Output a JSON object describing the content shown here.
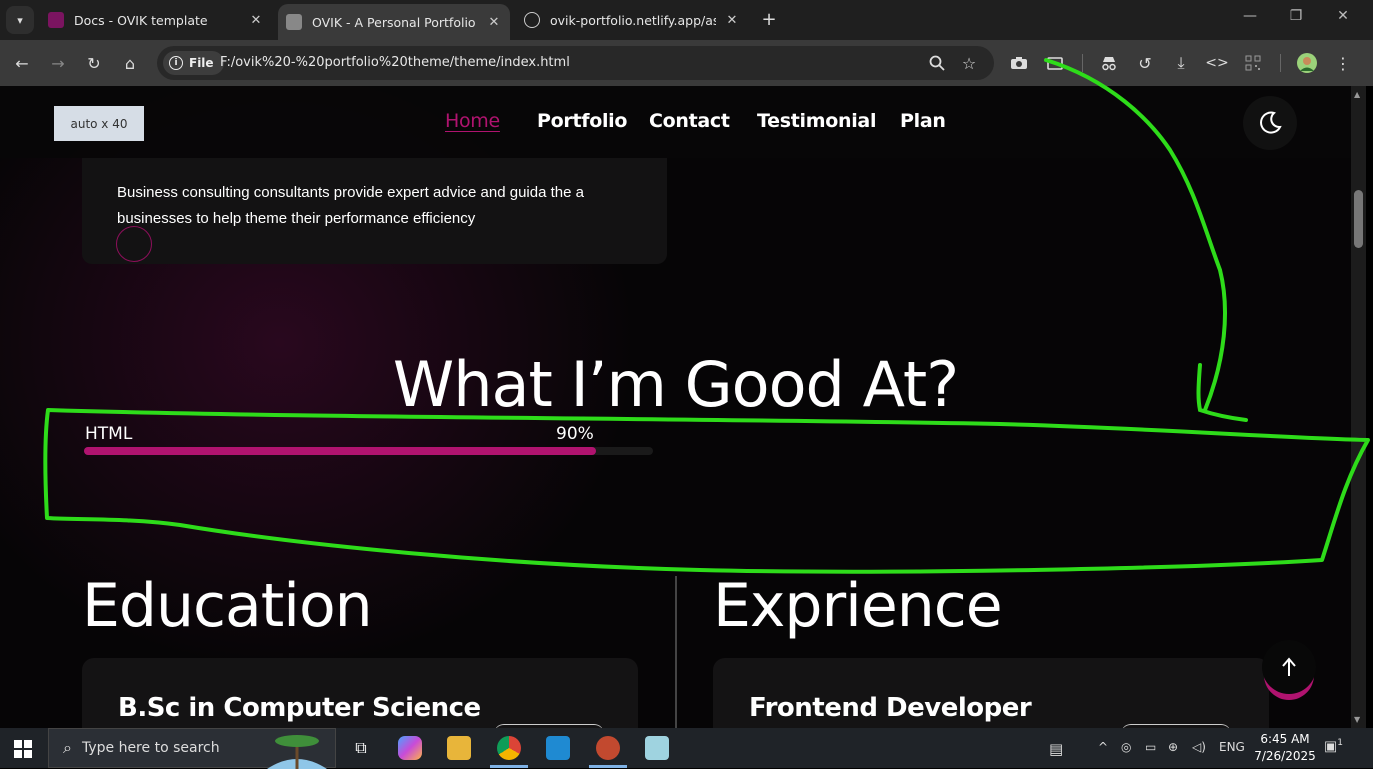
{
  "browser": {
    "tabs": [
      {
        "title": "Docs - OVIK template",
        "active": false
      },
      {
        "title": "OVIK - A Personal Portfolio Tem",
        "active": true
      },
      {
        "title": "ovik-portfolio.netlify.app/assets",
        "active": false
      }
    ],
    "new_tab": "+",
    "file_chip": "File",
    "url": "F:/ovik%20-%20portfolio%20theme/theme/index.html"
  },
  "page": {
    "auto_box": "auto x 40",
    "nav": [
      "Home",
      "Portfolio",
      "Contact",
      "Testimonial",
      "Plan"
    ],
    "testimonial_text": "Business consulting consultants provide expert advice and guida the a businesses to help theme their performance efficiency",
    "skills_heading": "What I’m Good At?",
    "skills": [
      {
        "name": "HTML",
        "percent_label": "90%",
        "value": 0.9
      }
    ],
    "education_title": "Education",
    "experience_title": "Exprience",
    "education_card_title": "B.Sc in Computer Science",
    "experience_card_title": "Frontend Developer",
    "accent_color": "#b0136f"
  },
  "taskbar": {
    "search_placeholder": "Type here to search",
    "language": "ENG",
    "time": "6:45 AM",
    "date": "7/26/2025",
    "notifications": "1"
  }
}
